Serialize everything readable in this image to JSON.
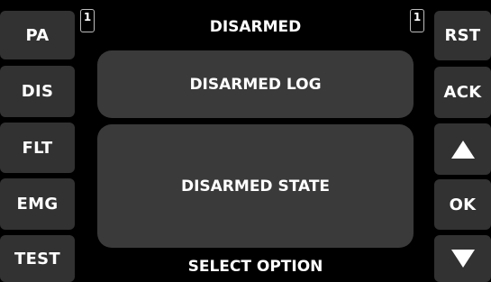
{
  "left_buttons": [
    {
      "label": "PA"
    },
    {
      "label": "DIS"
    },
    {
      "label": "FLT"
    },
    {
      "label": "EMG"
    },
    {
      "label": "TEST"
    }
  ],
  "right_buttons": {
    "reset": "RST",
    "acknowledge": "ACK",
    "up_icon": "triangle-up",
    "ok": "OK",
    "down_icon": "triangle-down"
  },
  "header": {
    "title": "DISARMED",
    "left_indicator": "1",
    "right_indicator": "1"
  },
  "main": {
    "log_panel": "DISARMED LOG",
    "state_panel": "DISARMED STATE"
  },
  "footer": {
    "prompt": "SELECT OPTION"
  },
  "colors": {
    "background": "#000000",
    "button": "#323232",
    "panel": "#3a3a3a",
    "text": "#ffffff"
  }
}
